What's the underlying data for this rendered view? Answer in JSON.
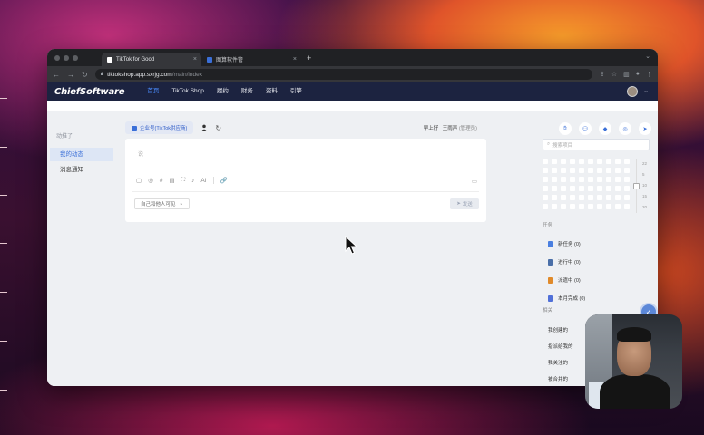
{
  "browser": {
    "tabs": [
      {
        "title": "TikTok for Good",
        "active": true
      },
      {
        "title": "图算软件管",
        "active": false
      }
    ],
    "new_tab": "+",
    "url": "tiktokshop.app.sxrjg.com",
    "url_path": "/main/index"
  },
  "app": {
    "logo_chief": "Chief",
    "logo_software": "Software",
    "menu": [
      "首页",
      "TikTok Shop",
      "履约",
      "财务",
      "资料",
      "引擎"
    ],
    "active_menu_index": 0
  },
  "sidebar": {
    "label": "动推了",
    "items": [
      {
        "label": "我的动态",
        "active": true
      },
      {
        "label": "消息通知",
        "active": false
      }
    ]
  },
  "post": {
    "company": "企业号(TikTok供应商)",
    "greeting": "早上好",
    "user": "王雨声",
    "role": "(管理员)",
    "placeholder": "说",
    "toolbar": [
      "▢",
      "◎",
      "#",
      "▤",
      "⛶",
      "♪",
      "AI"
    ],
    "toolbar_link": "🔗",
    "toolbar_right": "▭",
    "visibility": "自己和他人可见",
    "send": "发送"
  },
  "right_panel": {
    "search_placeholder": "搜索项目",
    "calendar_labels": [
      "22",
      "5",
      "10",
      "15",
      "20"
    ],
    "tasks_title": "任务",
    "tasks": [
      {
        "label": "新任务 (0)",
        "color": "#4a7fe0"
      },
      {
        "label": "进行中 (0)",
        "color": "#4a6fa8"
      },
      {
        "label": "派遣中 (0)",
        "color": "#e08a2a"
      },
      {
        "label": "本月完成 (0)",
        "color": "#5070d8"
      }
    ],
    "related_title": "相关",
    "related": [
      "我创建的",
      "指派给我的",
      "我关注的",
      "被合并的"
    ]
  },
  "colors": {
    "header_bg": "#1c2340",
    "accent": "#3a6fd8"
  }
}
